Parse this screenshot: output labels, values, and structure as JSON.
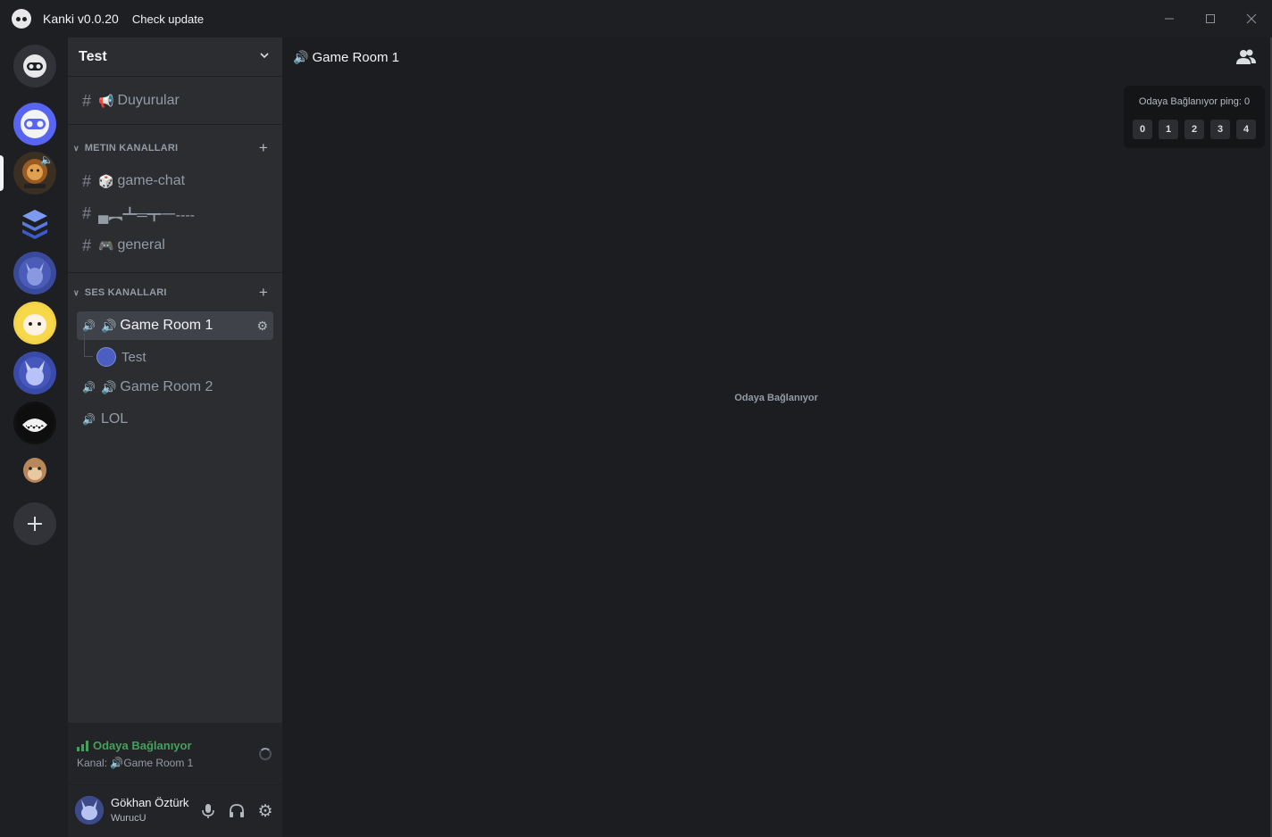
{
  "titlebar": {
    "title": "Kanki v0.0.20",
    "check_update": "Check update"
  },
  "guild": {
    "name": "Test"
  },
  "channels": {
    "announcement": {
      "name": "Duyurular",
      "emoji": "📢"
    },
    "text_category": "METIN KANALLARI",
    "text": [
      {
        "name": "game-chat",
        "emoji": "🎲"
      },
      {
        "name": "▄︻┻═┳一----",
        "emoji": ""
      },
      {
        "name": "general",
        "emoji": "🎮"
      }
    ],
    "voice_category": "SES KANALLARI",
    "voice": [
      {
        "name": "Game Room 1",
        "emoji": "🔊"
      },
      {
        "name": "Game Room 2",
        "emoji": "🔊"
      },
      {
        "name": "LOL",
        "emoji": ""
      }
    ],
    "voice_user": "Test"
  },
  "voice_panel": {
    "status": "Odaya Bağlanıyor",
    "channel_prefix": "Kanal:",
    "channel": "🔊Game Room 1"
  },
  "user": {
    "name": "Gökhan Öztürk",
    "tag": "WurucU"
  },
  "main": {
    "channel_title": "Game Room 1",
    "ping_label": "Odaya Bağlanıyor ping: 0",
    "ping_cells": [
      "0",
      "1",
      "2",
      "3",
      "4"
    ],
    "center_status": "Odaya Bağlanıyor"
  },
  "colors": {
    "accent": "#5865f2",
    "connecting_green": "#43a25a",
    "bg": "#1e1f22",
    "sidebar": "#2b2d31"
  },
  "icons": [
    "kanki-logo-icon",
    "minimize-icon",
    "maximize-icon",
    "close-icon",
    "chevron-down-icon",
    "plus-icon",
    "speaker-icon",
    "gear-icon",
    "microphone-icon",
    "headphones-icon",
    "members-icon"
  ]
}
